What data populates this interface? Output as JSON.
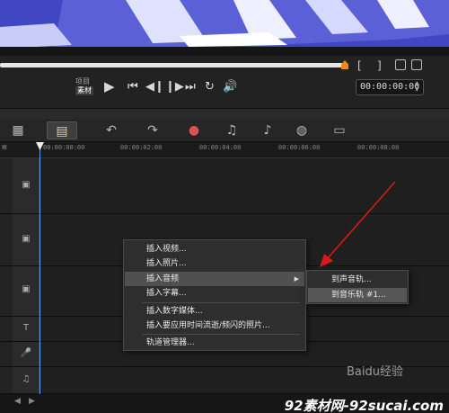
{
  "transport": {
    "mode_project": "项目",
    "mode_clip": "素材",
    "timecode": "00:00:00:00",
    "mark_in": "[",
    "mark_out": "]"
  },
  "ruler": {
    "ticks": [
      "00:00:00:00",
      "00:00:02:00",
      "00:00:04:00",
      "00:00:06:00",
      "00:00:08:00"
    ]
  },
  "context_menu": {
    "items": [
      {
        "label": "插入视频..."
      },
      {
        "label": "插入照片..."
      },
      {
        "label": "插入音频",
        "has_submenu": true
      },
      {
        "label": "插入字幕..."
      },
      {
        "label": "插入数字媒体..."
      },
      {
        "label": "插入要应用时间流逝/频闪的照片..."
      },
      {
        "label": "轨道管理器..."
      }
    ]
  },
  "submenu": {
    "items": [
      {
        "label": "到声音轨..."
      },
      {
        "label": "到音乐轨 #1..."
      }
    ]
  },
  "watermark": {
    "baidu": "Baidu经验",
    "site": "92素材网-92sucai.com"
  },
  "colors": {
    "preview": "#4a4fc4",
    "scrub_knob": "#e98a23",
    "playhead": "#5a9cff",
    "annotation": "#d41a1a"
  }
}
